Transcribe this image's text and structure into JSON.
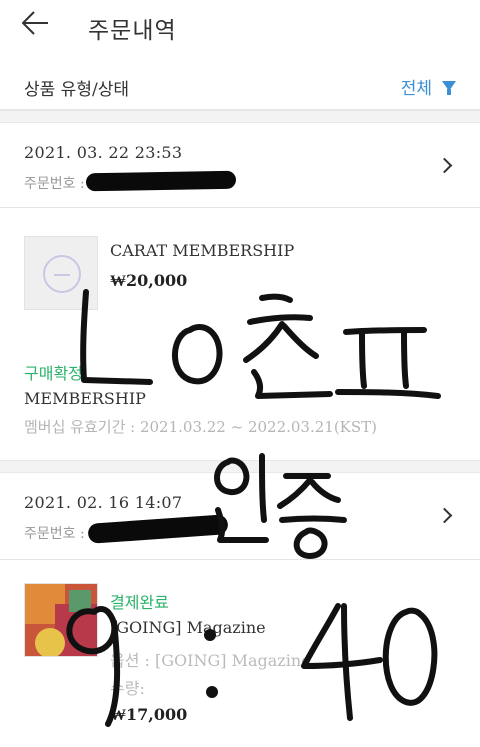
{
  "header": {
    "title": "주문내역",
    "back_icon": "arrow-left-icon"
  },
  "filter": {
    "label": "상품 유형/상태",
    "value": "전체",
    "icon": "funnel-icon",
    "accent": "#3b8fd6"
  },
  "orders": [
    {
      "date": "2021. 03. 22 23:53",
      "order_no_label": "주문번호 :",
      "product": {
        "name": "CARAT MEMBERSHIP",
        "price": "₩20,000"
      },
      "status": "구매확정",
      "type": "MEMBERSHIP",
      "validity": "멤버십 유효기간 : 2021.03.22 ~ 2022.03.21(KST)"
    },
    {
      "date": "2021. 02. 16 14:07",
      "order_no_label": "주문번호 :",
      "product": {
        "status": "결제완료",
        "name": "[GOING] Magazine",
        "option_line": "옵션 : [GOING] Magazine",
        "qty_line": "수량:",
        "price": "₩17,000"
      }
    }
  ],
  "colors": {
    "status_green": "#2ab36a",
    "divider": "#e6e6e6",
    "separator_bg": "#f3f3f3"
  }
}
